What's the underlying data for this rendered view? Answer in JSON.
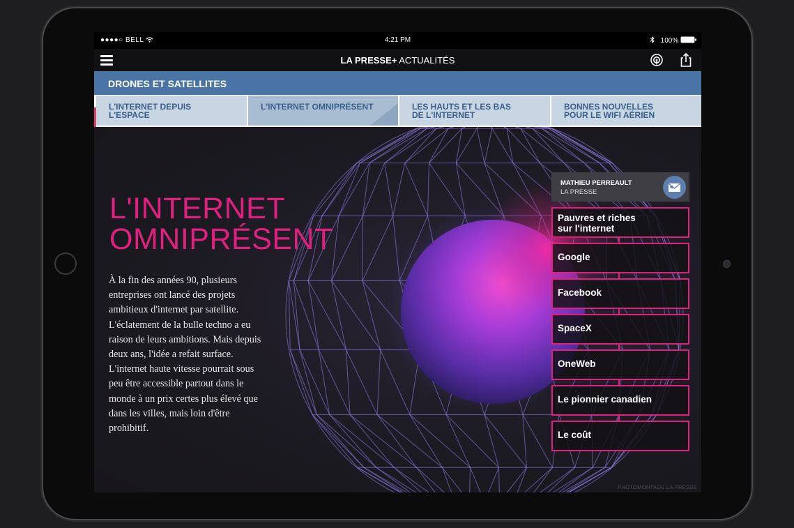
{
  "status": {
    "carrier": "BELL",
    "time": "4:21 PM",
    "battery": "100%"
  },
  "appbar": {
    "brand": "LA PRESSE+",
    "section": "ACTUALITÉS"
  },
  "section_title": "DRONES ET SATELLITES",
  "tabs": [
    {
      "line1": "L'INTERNET DEPUIS",
      "line2": "L'ESPACE"
    },
    {
      "line1": "L'INTERNET OMNIPRÉSENT",
      "line2": ""
    },
    {
      "line1": "LES HAUTS ET LES BAS",
      "line2": "DE L'INTERNET"
    },
    {
      "line1": "BONNES NOUVELLES",
      "line2": "POUR LE WIFI AÉRIEN"
    }
  ],
  "article": {
    "headline_line1": "L'INTERNET",
    "headline_line2": "OMNIPRÉSENT",
    "body": "À la fin des années 90, plusieurs entreprises ont lancé des projets ambitieux d'internet par satellite. L'éclatement de la bulle techno a eu raison de leurs ambitions. Mais depuis deux ans, l'idée a refait surface. L'internet haute vitesse pourrait sous peu être accessible partout dans le monde à un prix certes plus élevé que dans les villes, mais loin d'être prohibitif."
  },
  "author": {
    "name": "MATHIEU PERREAULT",
    "org": "LA PRESSE"
  },
  "nav": [
    {
      "line1": "Pauvres et riches",
      "line2": "sur l'internet"
    },
    {
      "line1": "Google",
      "line2": ""
    },
    {
      "line1": "Facebook",
      "line2": ""
    },
    {
      "line1": "SpaceX",
      "line2": ""
    },
    {
      "line1": "OneWeb",
      "line2": ""
    },
    {
      "line1": "Le pionnier canadien",
      "line2": ""
    },
    {
      "line1": "Le coût",
      "line2": ""
    }
  ],
  "credit": "PHOTOMONTAGE LA PRESSE",
  "colors": {
    "accent": "#e0207f",
    "section_blue": "#4a74a6",
    "tab_bg": "#c8d6e3"
  },
  "icons": [
    "menu-icon",
    "wifi-icon",
    "bluetooth-icon",
    "battery-icon",
    "podcast-icon",
    "share-icon",
    "mail-icon"
  ]
}
